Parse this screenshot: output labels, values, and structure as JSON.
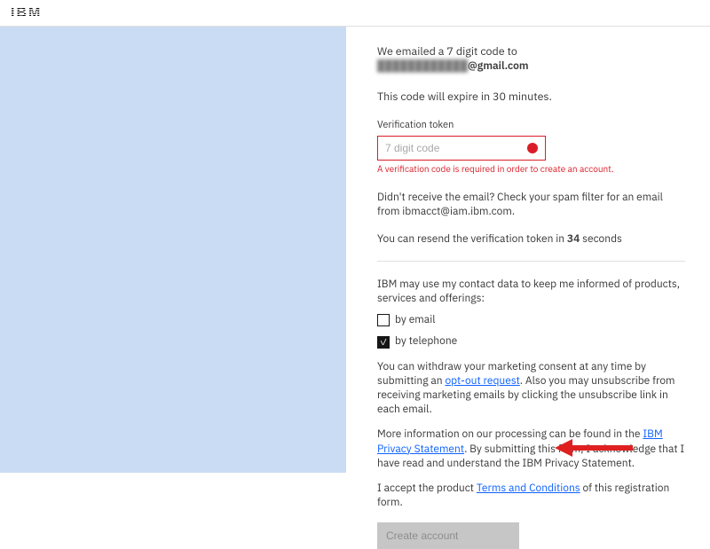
{
  "header": {
    "logo_text": "IBM"
  },
  "verify": {
    "emailed_line": "We emailed a 7 digit code to",
    "email_masked": "████████████",
    "email_suffix": "@gmail.com",
    "expire_line": "This code will expire in 30 minutes.",
    "field_label": "Verification token",
    "placeholder": "7 digit code",
    "error_msg": "A verification code is required in order to create an account.",
    "didnt_receive": "Didn't receive the email? Check your spam filter for an email from ibmacct@iam.ibm.com.",
    "resend_prefix": "You can resend the verification token in ",
    "resend_seconds": "34",
    "resend_suffix": " seconds"
  },
  "consent": {
    "intro": "IBM may use my contact data to keep me informed of products, services and offerings:",
    "by_email_label": "by email",
    "by_email_checked": false,
    "by_phone_label": "by telephone",
    "by_phone_checked": true,
    "withdraw_prefix": "You can withdraw your marketing consent at any time by submitting an ",
    "optout_link": "opt-out request",
    "withdraw_suffix": ". Also you may unsubscribe from receiving marketing emails by clicking the unsubscribe link in each email.",
    "more_prefix": "More information on our processing can be found in the ",
    "privacy_link": "IBM Privacy Statement",
    "more_suffix": ". By submitting this form, I acknowledge that I have read and understand the IBM Privacy Statement.",
    "accept_prefix": "I accept the product ",
    "terms_link": "Terms and Conditions",
    "accept_suffix": " of this registration form."
  },
  "submit": {
    "label": "Create account"
  },
  "colors": {
    "error": "#da1e28",
    "link": "#0f62fe",
    "left_panel": "#c9dcf3",
    "disabled_bg": "#c6c6c6"
  }
}
